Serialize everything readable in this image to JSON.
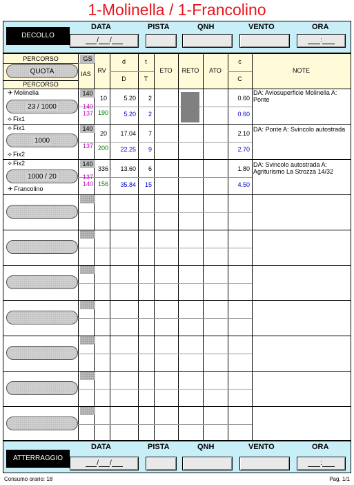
{
  "title": "1-Molinella / 1-Francolino",
  "takeoff": {
    "button": "DECOLLO",
    "headers": [
      "DATA",
      "PISTA",
      "QNH",
      "VENTO",
      "ORA"
    ],
    "date_sep": "/",
    "time_sep": ":"
  },
  "landing": {
    "button": "ATTERRAGGIO",
    "headers": [
      "DATA",
      "PISTA",
      "QNH",
      "VENTO",
      "ORA"
    ],
    "date_sep": "/",
    "time_sep": ":"
  },
  "table_header": {
    "percorso_top": "PERCORSO",
    "quota": "QUOTA",
    "percorso_bottom": "PERCORSO",
    "gs": "GS",
    "ias": "IAS",
    "rv": "RV",
    "d_small": "d",
    "d_big": "D",
    "t_small": "t",
    "t_big": "T",
    "eto": "ETO",
    "reto": "RETO",
    "ato": "ATO",
    "c_small": "c",
    "c_big": "C",
    "note": "NOTE"
  },
  "legs": [
    {
      "from": "Molinella",
      "from_icon": "plane-icon",
      "quota": "23 / 1000",
      "to": "Fix1",
      "to_icon": "fix-icon",
      "gs": "140",
      "ias1": "140",
      "ias2": "137",
      "rv": "10",
      "rv2": "190",
      "d": "5.20",
      "D": "5.20",
      "t": "2",
      "T": "2",
      "c": "0.60",
      "C": "0.60",
      "note": "DA: Aviosuperficie Molinella A: Ponte"
    },
    {
      "from": "Fix1",
      "from_icon": "fix-icon",
      "quota": "1000",
      "to": "Fix2",
      "to_icon": "fix-icon",
      "gs": "140",
      "ias1": "",
      "ias2": "137",
      "rv": "20",
      "rv2": "200",
      "d": "17.04",
      "D": "22.25",
      "t": "7",
      "T": "9",
      "c": "2.10",
      "C": "2.70",
      "note": "DA: Ponte A: Svincolo autostrada"
    },
    {
      "from": "Fix2",
      "from_icon": "fix-icon",
      "quota": "1000 / 20",
      "to": "Francolino",
      "to_icon": "plane-icon",
      "gs": "140",
      "ias1": "137",
      "ias2": "140",
      "rv": "336",
      "rv2": "156",
      "d": "13.60",
      "D": "35.84",
      "t": "6",
      "T": "15",
      "c": "1.80",
      "C": "4.50",
      "note": "DA: Svincolo autostrada A: Agriturismo La Strozza 14/32"
    }
  ],
  "footer": {
    "consumption": "Consumo orario: 18",
    "page": "Pag. 1/1"
  }
}
